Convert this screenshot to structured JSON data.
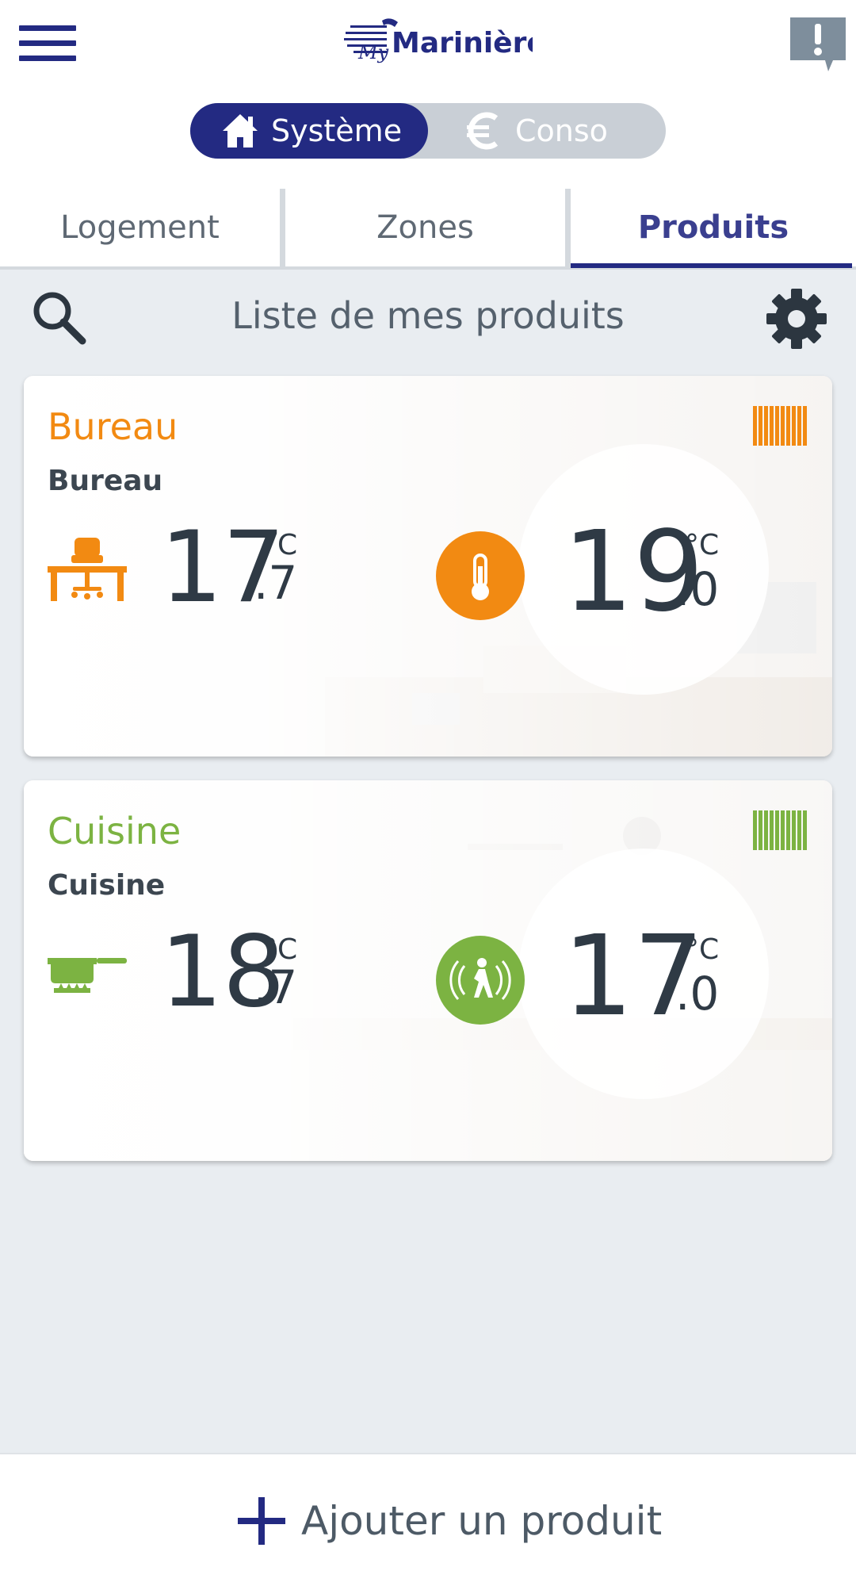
{
  "header": {
    "menu_icon": "hamburger-menu-icon",
    "logo_text": "My Marinière",
    "alert_icon": "exclamation-speech-bubble-icon"
  },
  "mode_toggle": {
    "active": {
      "label": "Système",
      "icon": "home-icon"
    },
    "inactive": {
      "label": "Conso",
      "icon": "euro-icon"
    }
  },
  "tabs": [
    {
      "label": "Logement",
      "active": false
    },
    {
      "label": "Zones",
      "active": false
    },
    {
      "label": "Produits",
      "active": true
    }
  ],
  "list": {
    "title": "Liste de mes produits",
    "search_icon": "search-icon",
    "settings_icon": "gear-icon"
  },
  "products": [
    {
      "name": "Bureau",
      "subtitle": "Bureau",
      "accent_color": "#f28a12",
      "room_icon": "desk-chair-icon",
      "status_icon": "radiator-icon",
      "current_temp": {
        "int": "17",
        "unit": "°C",
        "dec": ".7"
      },
      "mode_icon": "thermometer-icon",
      "setpoint": {
        "int": "19",
        "unit": "°C",
        "dec": ".0"
      }
    },
    {
      "name": "Cuisine",
      "subtitle": "Cuisine",
      "accent_color": "#7cb342",
      "room_icon": "cooking-pot-icon",
      "status_icon": "radiator-icon",
      "current_temp": {
        "int": "18",
        "unit": "°C",
        "dec": ".7"
      },
      "mode_icon": "presence-detection-icon",
      "setpoint": {
        "int": "17",
        "unit": "°C",
        "dec": ".0"
      }
    }
  ],
  "footer": {
    "add_label": "Ajouter un produit",
    "add_icon": "plus-icon"
  },
  "colors": {
    "brand_navy": "#232a82",
    "bureau_orange": "#f28a12",
    "cuisine_green": "#7cb342",
    "background": "#e9edf1"
  }
}
